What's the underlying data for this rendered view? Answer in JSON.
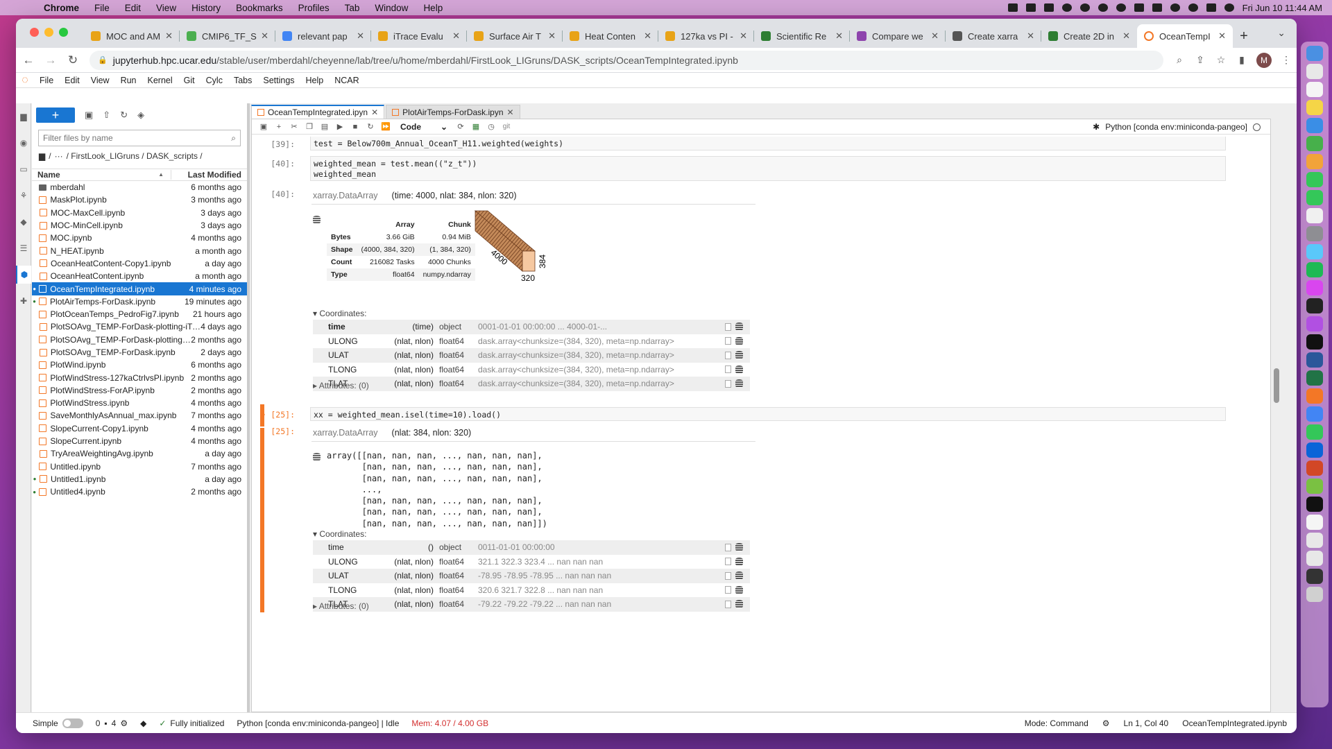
{
  "menubar": {
    "app": "Chrome",
    "items": [
      "File",
      "Edit",
      "View",
      "History",
      "Bookmarks",
      "Profiles",
      "Tab",
      "Window",
      "Help"
    ],
    "clock": "Fri Jun 10  11:44 AM"
  },
  "browser": {
    "tabs": [
      {
        "title": "MOC and AM",
        "color": "#e8a317"
      },
      {
        "title": "CMIP6_TF_S",
        "color": "#4caf50"
      },
      {
        "title": "relevant pap",
        "color": "#4285f4"
      },
      {
        "title": "iTrace Evalu",
        "color": "#e8a317"
      },
      {
        "title": "Surface Air T",
        "color": "#e8a317"
      },
      {
        "title": "Heat Conten",
        "color": "#e8a317"
      },
      {
        "title": "127ka vs PI -",
        "color": "#e8a317"
      },
      {
        "title": "Scientific Re",
        "color": "#2e7d32"
      },
      {
        "title": "Compare we",
        "color": "#8e44ad"
      },
      {
        "title": "Create xarra",
        "color": "#555555"
      },
      {
        "title": "Create 2D in",
        "color": "#2e7d32"
      },
      {
        "title": "OceanTempI",
        "color": "#f37726",
        "active": true
      }
    ],
    "url_host": "jupyterhub.hpc.ucar.edu",
    "url_path": "/stable/user/mberdahl/cheyenne/lab/tree/u/home/mberdahl/FirstLook_LIGruns/DASK_scripts/OceanTempIntegrated.ipynb",
    "profile_initial": "M"
  },
  "jupyter": {
    "menu": [
      "File",
      "Edit",
      "View",
      "Run",
      "Kernel",
      "Git",
      "Cylc",
      "Tabs",
      "Settings",
      "Help",
      "NCAR"
    ]
  },
  "filebrowser": {
    "filter_placeholder": "Filter files by name",
    "breadcrumb": [
      "/",
      "···",
      "/ FirstLook_LIGruns / DASK_scripts /"
    ],
    "col_name": "Name",
    "col_modified": "Last Modified",
    "files": [
      {
        "name": "mberdahl",
        "modified": "6 months ago",
        "folder": true
      },
      {
        "name": "MaskPlot.ipynb",
        "modified": "3 months ago"
      },
      {
        "name": "MOC-MaxCell.ipynb",
        "modified": "3 days ago"
      },
      {
        "name": "MOC-MinCell.ipynb",
        "modified": "3 days ago"
      },
      {
        "name": "MOC.ipynb",
        "modified": "4 months ago"
      },
      {
        "name": "N_HEAT.ipynb",
        "modified": "a month ago"
      },
      {
        "name": "OceanHeatContent-Copy1.ipynb",
        "modified": "a day ago"
      },
      {
        "name": "OceanHeatContent.ipynb",
        "modified": "a month ago"
      },
      {
        "name": "OceanTempIntegrated.ipynb",
        "modified": "4 minutes ago",
        "selected": true,
        "running": true
      },
      {
        "name": "PlotAirTemps-ForDask.ipynb",
        "modified": "19 minutes ago",
        "running": true
      },
      {
        "name": "PlotOceanTemps_PedroFig7.ipynb",
        "modified": "21 hours ago"
      },
      {
        "name": "PlotSOAvg_TEMP-ForDask-plotting-iTr...",
        "modified": "4 days ago"
      },
      {
        "name": "PlotSOAvg_TEMP-ForDask-plotting.ipy...",
        "modified": "2 months ago"
      },
      {
        "name": "PlotSOAvg_TEMP-ForDask.ipynb",
        "modified": "2 days ago"
      },
      {
        "name": "PlotWind.ipynb",
        "modified": "6 months ago"
      },
      {
        "name": "PlotWindStress-127kaCtrlvsPI.ipynb",
        "modified": "2 months ago"
      },
      {
        "name": "PlotWindStress-ForAP.ipynb",
        "modified": "2 months ago"
      },
      {
        "name": "PlotWindStress.ipynb",
        "modified": "4 months ago"
      },
      {
        "name": "SaveMonthlyAsAnnual_max.ipynb",
        "modified": "7 months ago"
      },
      {
        "name": "SlopeCurrent-Copy1.ipynb",
        "modified": "4 months ago"
      },
      {
        "name": "SlopeCurrent.ipynb",
        "modified": "4 months ago"
      },
      {
        "name": "TryAreaWeightingAvg.ipynb",
        "modified": "a day ago"
      },
      {
        "name": "Untitled.ipynb",
        "modified": "7 months ago"
      },
      {
        "name": "Untitled1.ipynb",
        "modified": "a day ago",
        "running": true
      },
      {
        "name": "Untitled4.ipynb",
        "modified": "2 months ago",
        "running": true
      }
    ]
  },
  "doctabs": [
    "OceanTempIntegrated.ipyn",
    "PlotAirTemps-ForDask.ipyn"
  ],
  "notebook": {
    "cell_type": "Code",
    "git_label": "git",
    "kernel": "Python [conda env:miniconda-pangeo]",
    "cell39": {
      "prompt": "[39]:",
      "code": "test = Below700m_Annual_OceanT_H11.weighted(weights)"
    },
    "cell40": {
      "prompt": "[40]:",
      "code_line1": "weighted_mean = test.mean((\"z_t\"))",
      "code_line2": "weighted_mean",
      "out_prompt": "[40]:"
    },
    "out40": {
      "cls": "xarray.DataArray",
      "dims": "(time: 4000, nlat: 384, nlon: 320)",
      "table": {
        "head": [
          "",
          "Array",
          "Chunk"
        ],
        "rows": [
          [
            "Bytes",
            "3.66 GiB",
            "0.94 MiB"
          ],
          [
            "Shape",
            "(4000, 384, 320)",
            "(1, 384, 320)"
          ],
          [
            "Count",
            "216082 Tasks",
            "4000 Chunks"
          ],
          [
            "Type",
            "float64",
            "numpy.ndarray"
          ]
        ]
      },
      "cube_labels": {
        "depth": "4000",
        "height": "384",
        "width": "320"
      },
      "coords_label": "▾ Coordinates:",
      "coords": [
        {
          "name": "time",
          "dims": "(time)",
          "dtype": "object",
          "preview": "0001-01-01 00:00:00 ... 4000-01-...",
          "bold": true
        },
        {
          "name": "ULONG",
          "dims": "(nlat, nlon)",
          "dtype": "float64",
          "preview": "dask.array<chunksize=(384, 320), meta=np.ndarray>"
        },
        {
          "name": "ULAT",
          "dims": "(nlat, nlon)",
          "dtype": "float64",
          "preview": "dask.array<chunksize=(384, 320), meta=np.ndarray>"
        },
        {
          "name": "TLONG",
          "dims": "(nlat, nlon)",
          "dtype": "float64",
          "preview": "dask.array<chunksize=(384, 320), meta=np.ndarray>"
        },
        {
          "name": "TLAT",
          "dims": "(nlat, nlon)",
          "dtype": "float64",
          "preview": "dask.array<chunksize=(384, 320), meta=np.ndarray>"
        }
      ],
      "attrs": "▸ Attributes: (0)"
    },
    "cell25": {
      "prompt": "• [25]:",
      "code": "xx = weighted_mean.isel(time=10).load()",
      "out_prompt": "[25]:"
    },
    "out25": {
      "cls": "xarray.DataArray",
      "dims": "(nlat: 384, nlon: 320)",
      "array": "array([[nan, nan, nan, ..., nan, nan, nan],\n       [nan, nan, nan, ..., nan, nan, nan],\n       [nan, nan, nan, ..., nan, nan, nan],\n       ...,\n       [nan, nan, nan, ..., nan, nan, nan],\n       [nan, nan, nan, ..., nan, nan, nan],\n       [nan, nan, nan, ..., nan, nan, nan]])",
      "coords_label": "▾ Coordinates:",
      "coords": [
        {
          "name": "time",
          "dims": "()",
          "dtype": "object",
          "preview": "0011-01-01 00:00:00"
        },
        {
          "name": "ULONG",
          "dims": "(nlat, nlon)",
          "dtype": "float64",
          "preview": "321.1 322.3 323.4 ... nan nan nan"
        },
        {
          "name": "ULAT",
          "dims": "(nlat, nlon)",
          "dtype": "float64",
          "preview": "-78.95 -78.95 -78.95 ... nan nan nan"
        },
        {
          "name": "TLONG",
          "dims": "(nlat, nlon)",
          "dtype": "float64",
          "preview": "320.6 321.7 322.8 ... nan nan nan"
        },
        {
          "name": "TLAT",
          "dims": "(nlat, nlon)",
          "dtype": "float64",
          "preview": "-79.22 -79.22 -79.22 ... nan nan nan"
        }
      ],
      "attrs": "▸ Attributes: (0)"
    }
  },
  "status": {
    "mode_label": "Simple",
    "terminals": "0",
    "kernels": "4",
    "init": "Fully initialized",
    "kernel": "Python [conda env:miniconda-pangeo] | Idle",
    "mem": "Mem: 4.07 / 4.00 GB",
    "cmd_mode": "Mode: Command",
    "cursor": "Ln 1, Col 40",
    "file": "OceanTempIntegrated.ipynb"
  },
  "colors": {
    "jupyter_orange": "#f37726",
    "selection_blue": "#1976d2",
    "mem_red": "#d32f2f"
  }
}
